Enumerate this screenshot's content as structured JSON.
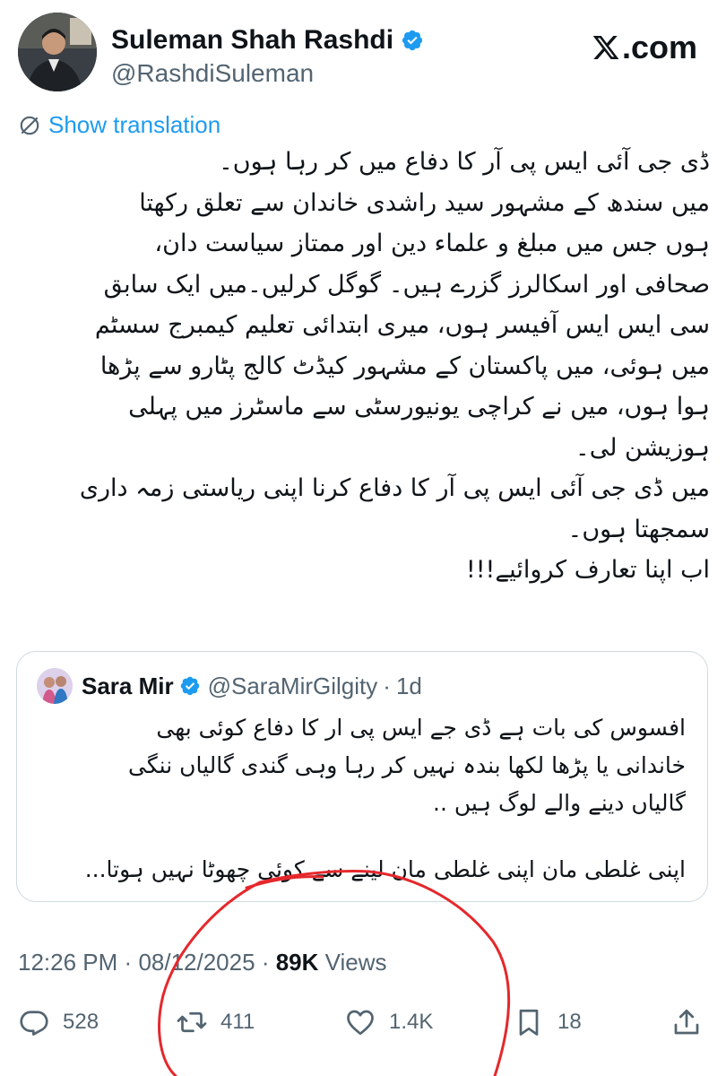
{
  "author": {
    "display_name": "Suleman Shah Rashdi",
    "handle": "@RashdiSuleman",
    "verified": true
  },
  "brand": {
    "label": ".com",
    "logo_icon": "x-logo-icon"
  },
  "translate_label": "Show translation",
  "tweet_lines": [
    "ڈی جی آئی ایس پی آر کا دفاع میں کر رہا ہوں۔",
    "میں سندھ کے مشہور سید راشدی خاندان سے تعلق رکھتا",
    "ہوں جس میں مبلغ و علماء دین اور ممتاز سیاست دان،",
    "صحافی اور اسکالرز گزرے ہیں۔ گوگل کرلیں۔میں ایک سابق",
    "سی ایس ایس آفیسر ہوں، میری ابتدائی تعلیم کیمبرج سسٹم",
    "میں ہوئی، میں پاکستان کے مشہور کیڈٹ کالج پٹارو سے پڑھا",
    "ہوا ہوں، میں نے کراچی یونیورسٹی سے ماسٹرز میں پہلی",
    "ہوزیشن لی۔",
    "میں ڈی جی آئی ایس پی آر کا دفاع کرنا اپنی ریاستی زمہ داری",
    "سمجھتا ہوں۔",
    "اب اپنا تعارف کروائیے!!!"
  ],
  "quote": {
    "display_name": "Sara Mir",
    "handle": "@SaraMirGilgity",
    "separator": "·",
    "time": "1d",
    "lines_block1": [
      "افسوس کی بات ہے ڈی جے ایس پی ار کا دفاع کوئی بھی",
      "خاندانی یا پڑھا لکھا بندہ نہیں کر رہا وہی گندی گالیاں ننگی",
      "گالیاں دینے والے لوگ ہیں .."
    ],
    "lines_block2": [
      "اپنی غلطی مان اپنی غلطی مان لینے سے کوئی چھوٹا نہیں ہوتا..."
    ]
  },
  "meta": {
    "time": "12:26 PM",
    "separator": "·",
    "date": "08/12/2025",
    "views_count": "89K",
    "views_label": "Views"
  },
  "actions": {
    "replies": "528",
    "reposts": "411",
    "likes": "1.4K",
    "bookmarks": "18"
  },
  "colors": {
    "link_blue": "#1d9bf0",
    "secondary_text": "#536471",
    "primary_text": "#0f1419",
    "border": "#cfd9de",
    "annotation_red": "#e5282c"
  }
}
